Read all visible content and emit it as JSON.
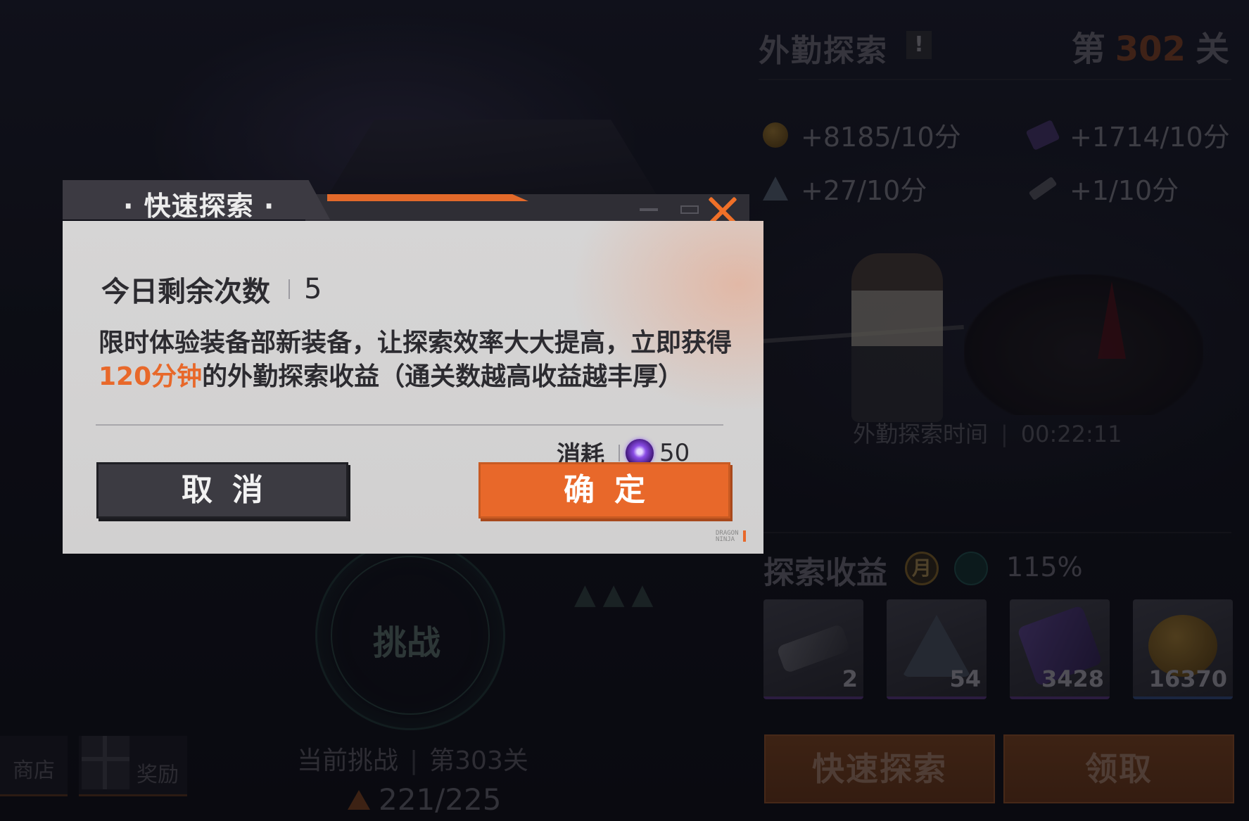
{
  "background": {
    "outpost": {
      "title": "外勤探索",
      "alert": "!",
      "stage_prefix": "第",
      "stage_number": "302",
      "stage_suffix": "关",
      "rates": [
        {
          "icon": "gold-coin-icon",
          "text": "+8185/10分"
        },
        {
          "icon": "purple-book-icon",
          "text": "+1714/10分"
        },
        {
          "icon": "crystal-shard-icon",
          "text": "+27/10分"
        },
        {
          "icon": "key-item-icon",
          "text": "+1/10分"
        }
      ],
      "explore_time_label": "外勤探索时间",
      "explore_time_value": "00:22:11"
    },
    "gains": {
      "title": "探索收益",
      "month_badge": "月",
      "bonus_percent": "115%",
      "items": [
        {
          "icon": "ticket-item-icon",
          "count": "2"
        },
        {
          "icon": "crystal-shard-icon",
          "count": "54"
        },
        {
          "icon": "purple-book-icon",
          "count": "3428"
        },
        {
          "icon": "gold-coin-icon",
          "count": "16370"
        }
      ],
      "quick_explore_label": "快速探索",
      "claim_label": "领取"
    },
    "challenge": {
      "label": "挑战",
      "current_label": "当前挑战",
      "current_stage": "第303关",
      "progress": "221/225",
      "triangles": "▲▲▲"
    },
    "shop_label": "商店",
    "reward_label": "奖励"
  },
  "dialog": {
    "title": "· 快速探索 ·",
    "remaining_label": "今日剩余次数",
    "remaining_value": "5",
    "desc_part1": "限时体验装备部新装备，让探索效率大大提高，立即获得",
    "desc_highlight": "120分钟",
    "desc_part2": "的外勤探索收益（通关数越高收益越丰厚）",
    "cost_label": "消耗",
    "cost_value": "50",
    "cancel_label": "取消",
    "confirm_label": "确定",
    "watermark": "DRAGON\nNINJA"
  },
  "colors": {
    "accent": "#e8682a",
    "dialog_bg": "#d6d5d5",
    "header_dark": "#3c3a42"
  }
}
